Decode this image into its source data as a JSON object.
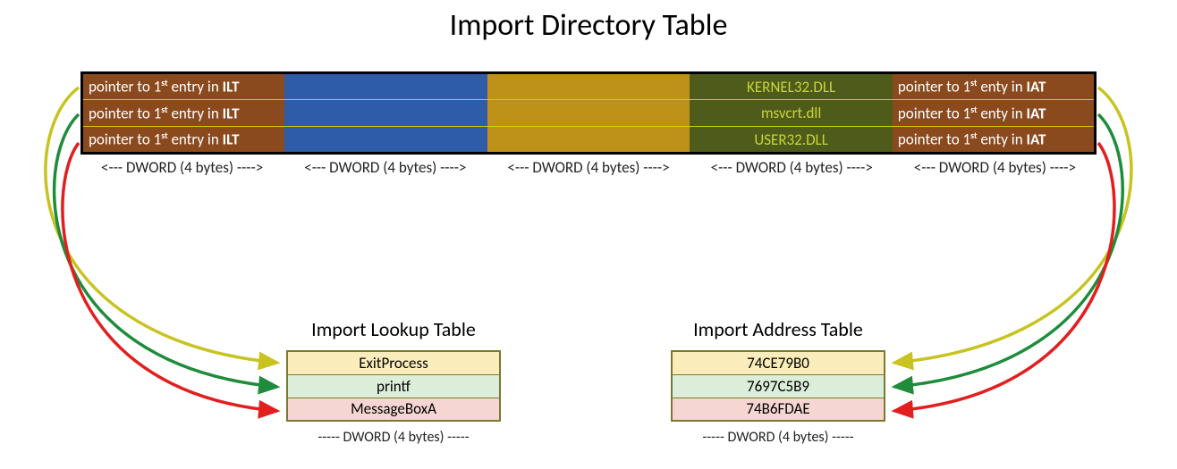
{
  "title": "Import Directory Table",
  "idt": {
    "rows": [
      {
        "ilt_html": "pointer to 1<sup>st</sup> entry in <span class='bold'>ILT</span>",
        "name": "KERNEL32.DLL",
        "iat_html": "pointer to 1<sup>st</sup> enty in <span class='bold'>IAT</span>"
      },
      {
        "ilt_html": "pointer to 1<sup>st</sup> entry in <span class='bold'>ILT</span>",
        "name": "msvcrt.dll",
        "iat_html": "pointer to 1<sup>st</sup> enty in <span class='bold'>IAT</span>"
      },
      {
        "ilt_html": "pointer to 1<sup>st</sup> entry in <span class='bold'>ILT</span>",
        "name": "USER32.DLL",
        "iat_html": "pointer to 1<sup>st</sup> enty in <span class='bold'>IAT</span>"
      }
    ],
    "dword_label": "<--- DWORD (4 bytes) ---->",
    "columns": 5
  },
  "ilt": {
    "title": "Import Lookup Table",
    "rows": [
      "ExitProcess",
      "printf",
      "MessageBoxA"
    ],
    "foot": "----- DWORD (4 bytes) -----"
  },
  "iat": {
    "title": "Import Address Table",
    "rows": [
      "74CE79B0",
      "7697C5B9",
      "74B6FDAE"
    ],
    "foot": "----- DWORD (4 bytes) -----"
  },
  "arrow_colors": {
    "yellow": "#C8C320",
    "green": "#1E8C3A",
    "red": "#E21E1E"
  }
}
